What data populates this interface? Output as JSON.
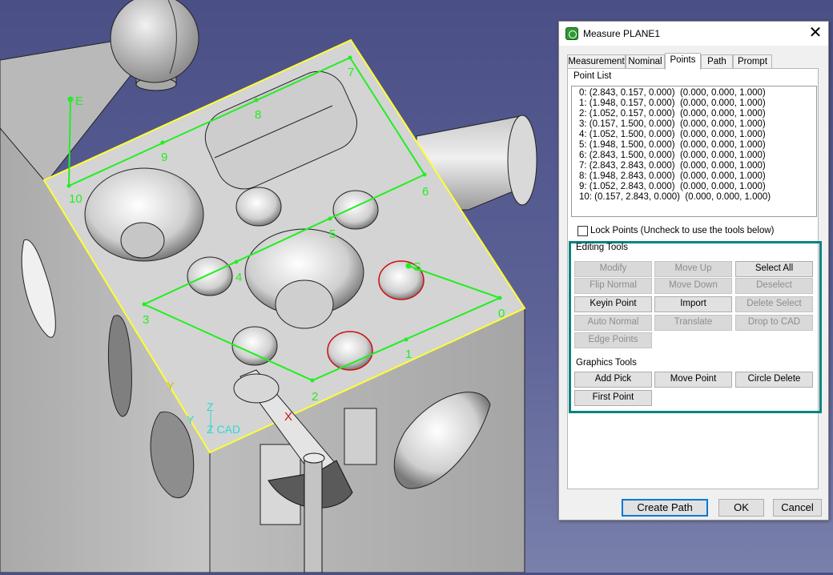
{
  "viewport": {
    "point_labels": [
      "0",
      "1",
      "2",
      "3",
      "4",
      "5",
      "6",
      "7",
      "8",
      "9",
      "10"
    ],
    "start_label": "S",
    "end_label": "E",
    "axis": {
      "x": "X",
      "y": "Y",
      "z": "Z",
      "cad": "Z CAD"
    },
    "colors": {
      "path": "#22ee22",
      "plane_outline": "#ffff33",
      "part": "#d4d4d4",
      "highlight": "#cc1111",
      "axis": "#33d6d6"
    }
  },
  "dialog": {
    "title": "Measure PLANE1",
    "icon": "app-icon",
    "close_glyph": "✕",
    "tabs": [
      "Measurement",
      "Nominal",
      "Points",
      "Path",
      "Prompt"
    ],
    "active_tab": "Points",
    "point_list": {
      "label": "Point List",
      "rows": [
        "0: (2.843, 0.157, 0.000)  (0.000, 0.000, 1.000)",
        "1: (1.948, 0.157, 0.000)  (0.000, 0.000, 1.000)",
        "2: (1.052, 0.157, 0.000)  (0.000, 0.000, 1.000)",
        "3: (0.157, 1.500, 0.000)  (0.000, 0.000, 1.000)",
        "4: (1.052, 1.500, 0.000)  (0.000, 0.000, 1.000)",
        "5: (1.948, 1.500, 0.000)  (0.000, 0.000, 1.000)",
        "6: (2.843, 1.500, 0.000)  (0.000, 0.000, 1.000)",
        "7: (2.843, 2.843, 0.000)  (0.000, 0.000, 1.000)",
        "8: (1.948, 2.843, 0.000)  (0.000, 0.000, 1.000)",
        "9: (1.052, 2.843, 0.000)  (0.000, 0.000, 1.000)",
        "10: (0.157, 2.843, 0.000)  (0.000, 0.000, 1.000)"
      ]
    },
    "lock_points": {
      "label": "Lock Points  (Uncheck to use the tools below)",
      "checked": false
    },
    "editing_tools": {
      "label": "Editing Tools",
      "buttons": [
        {
          "label": "Modify",
          "enabled": false
        },
        {
          "label": "Move Up",
          "enabled": false
        },
        {
          "label": "Select All",
          "enabled": true
        },
        {
          "label": "Flip Normal",
          "enabled": false
        },
        {
          "label": "Move Down",
          "enabled": false
        },
        {
          "label": "Deselect",
          "enabled": false
        },
        {
          "label": "Keyin Point",
          "enabled": true
        },
        {
          "label": "Import",
          "enabled": true
        },
        {
          "label": "Delete Select",
          "enabled": false
        },
        {
          "label": "Auto Normal",
          "enabled": false
        },
        {
          "label": "Translate",
          "enabled": false
        },
        {
          "label": "Drop to CAD",
          "enabled": false
        },
        {
          "label": "Edge Points",
          "enabled": false
        }
      ]
    },
    "graphics_tools": {
      "label": "Graphics Tools",
      "buttons": [
        {
          "label": "Add Pick",
          "enabled": true
        },
        {
          "label": "Move Point",
          "enabled": true
        },
        {
          "label": "Circle Delete",
          "enabled": true
        },
        {
          "label": "First Point",
          "enabled": true
        }
      ]
    },
    "footer": {
      "create_path": "Create Path",
      "ok": "OK",
      "cancel": "Cancel"
    },
    "colors": {
      "group_border": "#0b8383",
      "default_button_border": "#0078d7"
    }
  }
}
